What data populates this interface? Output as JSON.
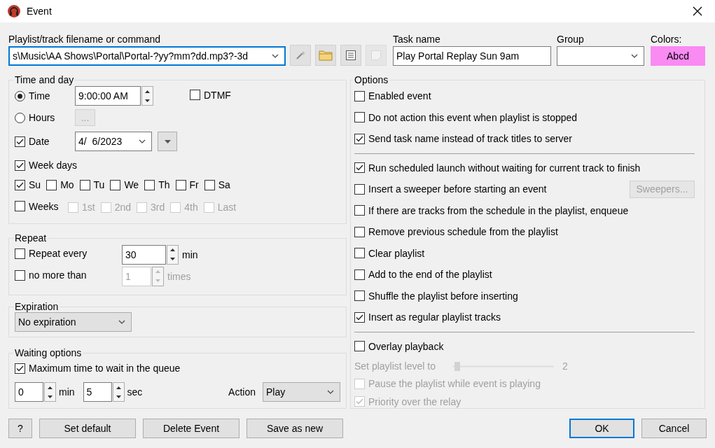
{
  "window": {
    "title": "Event"
  },
  "command": {
    "label": "Playlist/track filename or command",
    "value": "s\\Music\\AA Shows\\Portal\\Portal-?yy?mm?dd.mp3?-3d"
  },
  "tools": [
    {
      "kind": "wand",
      "disabled": false
    },
    {
      "kind": "folder",
      "disabled": false
    },
    {
      "kind": "list",
      "disabled": false
    },
    {
      "kind": "note",
      "disabled": true
    }
  ],
  "task_name": {
    "label": "Task name",
    "value": "Play Portal Replay Sun 9am"
  },
  "group": {
    "label": "Group"
  },
  "colors": {
    "label": "Colors:",
    "sample": "Abcd",
    "color": "#f98bf3"
  },
  "time_and_day": {
    "title": "Time and day",
    "time": {
      "label": "Time",
      "selected": true,
      "value": "9:00:00 AM"
    },
    "dtmf": {
      "label": "DTMF",
      "checked": false
    },
    "hours": {
      "label": "Hours",
      "selected": false,
      "button": "...",
      "button_disabled": true
    },
    "date": {
      "label": "Date",
      "checked": true,
      "value": "4/  6/2023"
    },
    "week_days": {
      "label": "Week days",
      "checked": true
    },
    "days": [
      {
        "label": "Su",
        "checked": true
      },
      {
        "label": "Mo",
        "checked": false
      },
      {
        "label": "Tu",
        "checked": false
      },
      {
        "label": "We",
        "checked": false
      },
      {
        "label": "Th",
        "checked": false
      },
      {
        "label": "Fr",
        "checked": false
      },
      {
        "label": "Sa",
        "checked": false
      }
    ],
    "weeks": {
      "label": "Weeks",
      "checked": false
    },
    "week_numbers": [
      {
        "label": "1st",
        "checked": false,
        "disabled": true
      },
      {
        "label": "2nd",
        "checked": false,
        "disabled": true
      },
      {
        "label": "3rd",
        "checked": false,
        "disabled": true
      },
      {
        "label": "4th",
        "checked": false,
        "disabled": true
      },
      {
        "label": "Last",
        "checked": false,
        "disabled": true
      }
    ]
  },
  "repeat": {
    "title": "Repeat",
    "rows": [
      {
        "label": "Repeat every",
        "checked": false,
        "value": "30",
        "unit": "min",
        "field_disabled": false
      },
      {
        "label": "no more than",
        "checked": false,
        "value": "1",
        "unit": "times",
        "field_disabled": true
      }
    ]
  },
  "expiration": {
    "title": "Expiration",
    "value": "No expiration"
  },
  "waiting": {
    "title": "Waiting options",
    "max_wait": {
      "label": "Maximum time to wait in the queue",
      "checked": true
    },
    "min_value": "0",
    "min_unit": "min",
    "sec_value": "5",
    "sec_unit": "sec",
    "action_label": "Action",
    "action_value": "Play"
  },
  "options": {
    "title": "Options",
    "items": [
      {
        "kind": "check",
        "label": "Enabled event",
        "checked": false,
        "disabled": false
      },
      {
        "kind": "check",
        "label": "Do not action this event when playlist is stopped",
        "checked": false,
        "disabled": false
      },
      {
        "kind": "check",
        "label": "Send task name instead of track titles to server",
        "checked": true,
        "disabled": false
      },
      {
        "kind": "separator"
      },
      {
        "kind": "check",
        "label": "Run scheduled launch without waiting for current track to finish",
        "checked": true,
        "disabled": false
      },
      {
        "kind": "check",
        "label": "Insert a sweeper before starting an event",
        "checked": false,
        "disabled": false,
        "button": "Sweepers...",
        "button_disabled": true
      },
      {
        "kind": "check",
        "label": "If there are tracks from the schedule in the playlist, enqueue",
        "checked": false,
        "disabled": false
      },
      {
        "kind": "check",
        "label": "Remove previous schedule from the playlist",
        "checked": false,
        "disabled": false
      },
      {
        "kind": "check",
        "label": "Clear playlist",
        "checked": false,
        "disabled": false
      },
      {
        "kind": "check",
        "label": "Add to the end of the playlist",
        "checked": false,
        "disabled": false
      },
      {
        "kind": "check",
        "label": "Shuffle the playlist before inserting",
        "checked": false,
        "disabled": false
      },
      {
        "kind": "check",
        "label": "Insert as regular playlist tracks",
        "checked": true,
        "disabled": false
      },
      {
        "kind": "separator"
      },
      {
        "kind": "check",
        "label": "Overlay playback",
        "checked": false,
        "disabled": false
      },
      {
        "kind": "slider",
        "label": "Set playlist level to",
        "level": 0.02,
        "reading": "2",
        "disabled": true
      },
      {
        "kind": "check",
        "label": "Pause the playlist while event is playing",
        "checked": false,
        "disabled": true
      },
      {
        "kind": "check",
        "label": "Priority over the relay",
        "checked": true,
        "disabled": true
      }
    ]
  },
  "buttons_left": [
    {
      "label": "?"
    },
    {
      "label": "Set default"
    },
    {
      "label": "Delete Event"
    },
    {
      "label": "Save as new"
    }
  ],
  "buttons_right": [
    {
      "label": "OK",
      "default": true
    },
    {
      "label": "Cancel",
      "default": false
    }
  ]
}
